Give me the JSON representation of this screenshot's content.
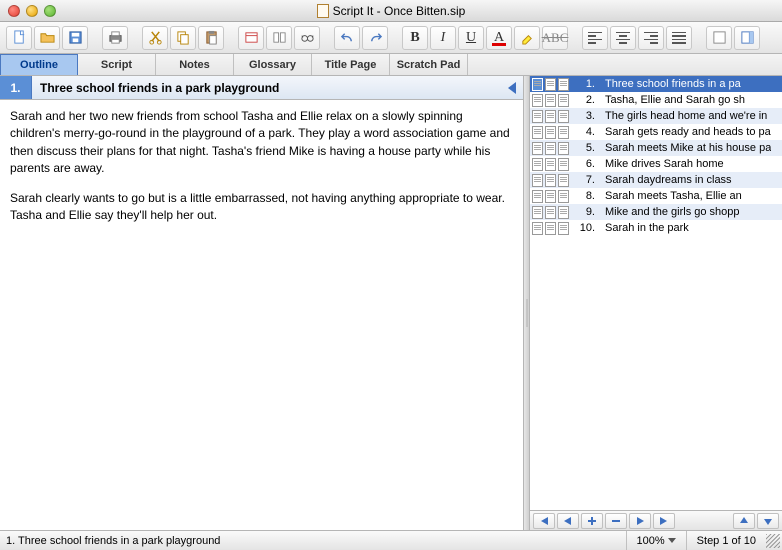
{
  "window": {
    "title": "Script It - Once Bitten.sip"
  },
  "tabs": [
    {
      "label": "Outline",
      "active": true
    },
    {
      "label": "Script"
    },
    {
      "label": "Notes"
    },
    {
      "label": "Glossary"
    },
    {
      "label": "Title Page"
    },
    {
      "label": "Scratch Pad"
    }
  ],
  "card": {
    "num": "1.",
    "title": "Three school friends in a park playground",
    "para1": "Sarah and her two new friends from school Tasha and Ellie relax on a slowly spinning children's merry-go-round in the playground of a park.  They play a word association game and then discuss their plans for that night.  Tasha's friend Mike is having a house party while his parents are away.",
    "para2": "Sarah clearly wants to go but is a little embarrassed, not having anything appropriate to wear.  Tasha and Ellie say they'll help her out."
  },
  "navigator": {
    "items": [
      {
        "n": "1.",
        "t": "Three school friends in a pa",
        "sel": true
      },
      {
        "n": "2.",
        "t": "Tasha, Ellie and Sarah go sh"
      },
      {
        "n": "3.",
        "t": "The girls head home and we're in",
        "alt": true
      },
      {
        "n": "4.",
        "t": "Sarah gets ready and heads to pa"
      },
      {
        "n": "5.",
        "t": "Sarah meets Mike at his house pa",
        "alt": true
      },
      {
        "n": "6.",
        "t": "Mike drives Sarah home"
      },
      {
        "n": "7.",
        "t": "Sarah daydreams in class",
        "alt": true
      },
      {
        "n": "8.",
        "t": "Sarah meets Tasha, Ellie an"
      },
      {
        "n": "9.",
        "t": "Mike and the girls go shopp",
        "alt": true
      },
      {
        "n": "10.",
        "t": "Sarah in the park"
      }
    ]
  },
  "status": {
    "left": "1.  Three school friends in a park playground",
    "zoom": "100%",
    "step": "Step 1 of 10"
  },
  "glyphs": {
    "B": "B",
    "I": "I",
    "U": "U",
    "A": "A",
    "ABC": "ABC"
  }
}
